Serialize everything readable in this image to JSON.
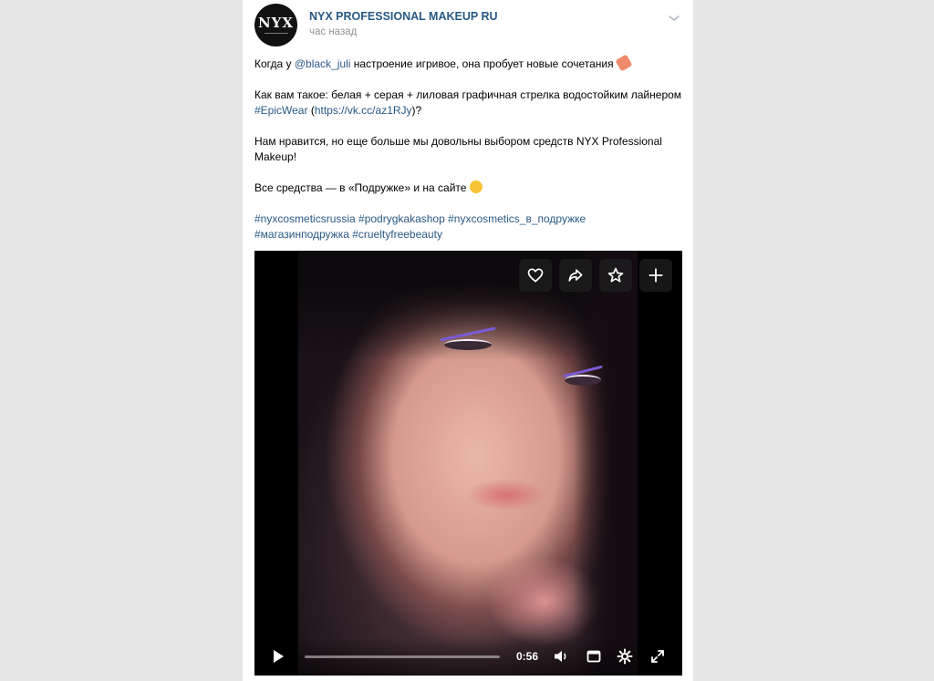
{
  "post": {
    "author": "NYX PROFESSIONAL MAKEUP RU",
    "time": "час назад",
    "avatar_text": "NYX",
    "p1_pre": "Когда у ",
    "p1_mention": "@black_juli",
    "p1_post": " настроение игривое, она пробует новые сочетания",
    "p2_pre": "Как вам такое: белая + серая + лиловая графичная стрелка водостойким лайнером ",
    "p2_tag": "#EpicWear",
    "p2_mid": " (",
    "p2_url": "https://vk.cc/az1RJy",
    "p2_post": ")?",
    "p3": "Нам нравится, но еще больше мы довольны выбором средств NYX Professional Makeup!",
    "p4": "Все средства — в «Подружке» и на сайте",
    "tags_line1": "#nyxcosmeticsrussia #podrygkakashop #nyxcosmetics_в_подружке",
    "tags_line2": "#магазинподружка #crueltyfreebeauty"
  },
  "video": {
    "duration": "0:56",
    "progress": 0.0,
    "actions": [
      "heart-icon",
      "share-icon",
      "star-icon",
      "plus-icon"
    ],
    "controls": [
      "play-icon",
      "volume-icon",
      "miniplayer-icon",
      "settings-icon",
      "fullscreen-icon"
    ]
  },
  "colors": {
    "link": "#2a5885",
    "meta": "#939393",
    "page_bg": "#e6e6e6"
  }
}
